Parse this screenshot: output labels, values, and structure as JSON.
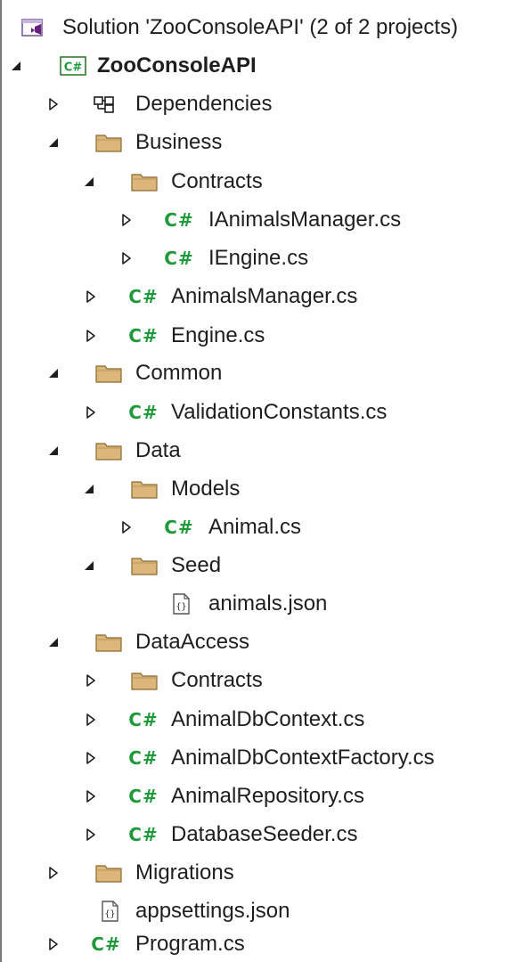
{
  "solution": {
    "label": "Solution 'ZooConsoleAPI' (2 of 2 projects)",
    "icon": "visual-studio-solution-icon"
  },
  "project": {
    "label": "ZooConsoleAPI",
    "icon": "csharp-project-icon",
    "expanded": true
  },
  "nodes": {
    "dependencies": {
      "label": "Dependencies",
      "icon": "dependencies-icon",
      "expanded": false
    },
    "business": {
      "label": "Business",
      "icon": "folder-icon",
      "expanded": true
    },
    "business_contracts": {
      "label": "Contracts",
      "icon": "folder-icon",
      "expanded": true
    },
    "ianimalsmanager": {
      "label": "IAnimalsManager.cs",
      "icon": "csharp-file-icon",
      "expanded": false
    },
    "iengine": {
      "label": "IEngine.cs",
      "icon": "csharp-file-icon",
      "expanded": false
    },
    "animalsmanager": {
      "label": "AnimalsManager.cs",
      "icon": "csharp-file-icon",
      "expanded": false
    },
    "engine": {
      "label": "Engine.cs",
      "icon": "csharp-file-icon",
      "expanded": false
    },
    "common": {
      "label": "Common",
      "icon": "folder-icon",
      "expanded": true
    },
    "validationconstants": {
      "label": "ValidationConstants.cs",
      "icon": "csharp-file-icon",
      "expanded": false
    },
    "data": {
      "label": "Data",
      "icon": "folder-icon",
      "expanded": true
    },
    "models": {
      "label": "Models",
      "icon": "folder-icon",
      "expanded": true
    },
    "animal": {
      "label": "Animal.cs",
      "icon": "csharp-file-icon",
      "expanded": false
    },
    "seed": {
      "label": "Seed",
      "icon": "folder-icon",
      "expanded": true
    },
    "animalsjson": {
      "label": "animals.json",
      "icon": "json-file-icon"
    },
    "dataaccess": {
      "label": "DataAccess",
      "icon": "folder-icon",
      "expanded": true
    },
    "dataaccess_contracts": {
      "label": "Contracts",
      "icon": "folder-icon",
      "expanded": false
    },
    "animaldbcontext": {
      "label": "AnimalDbContext.cs",
      "icon": "csharp-file-icon",
      "expanded": false
    },
    "animaldbcontextfactory": {
      "label": "AnimalDbContextFactory.cs",
      "icon": "csharp-file-icon",
      "expanded": false
    },
    "animalrepository": {
      "label": "AnimalRepository.cs",
      "icon": "csharp-file-icon",
      "expanded": false
    },
    "databaseseeder": {
      "label": "DatabaseSeeder.cs",
      "icon": "csharp-file-icon",
      "expanded": false
    },
    "migrations": {
      "label": "Migrations",
      "icon": "folder-icon",
      "expanded": false
    },
    "appsettings": {
      "label": "appsettings.json",
      "icon": "json-file-icon"
    },
    "program": {
      "label": "Program.cs",
      "icon": "csharp-file-icon",
      "expanded": false
    }
  },
  "icons": {
    "csharp_glyph": "C#"
  },
  "colors": {
    "folder_fill": "#dcb67a",
    "folder_stroke": "#8a6a30",
    "csharp_green": "#1e9a3a",
    "vs_purple": "#68217a",
    "expander": "#1e1e1e"
  }
}
